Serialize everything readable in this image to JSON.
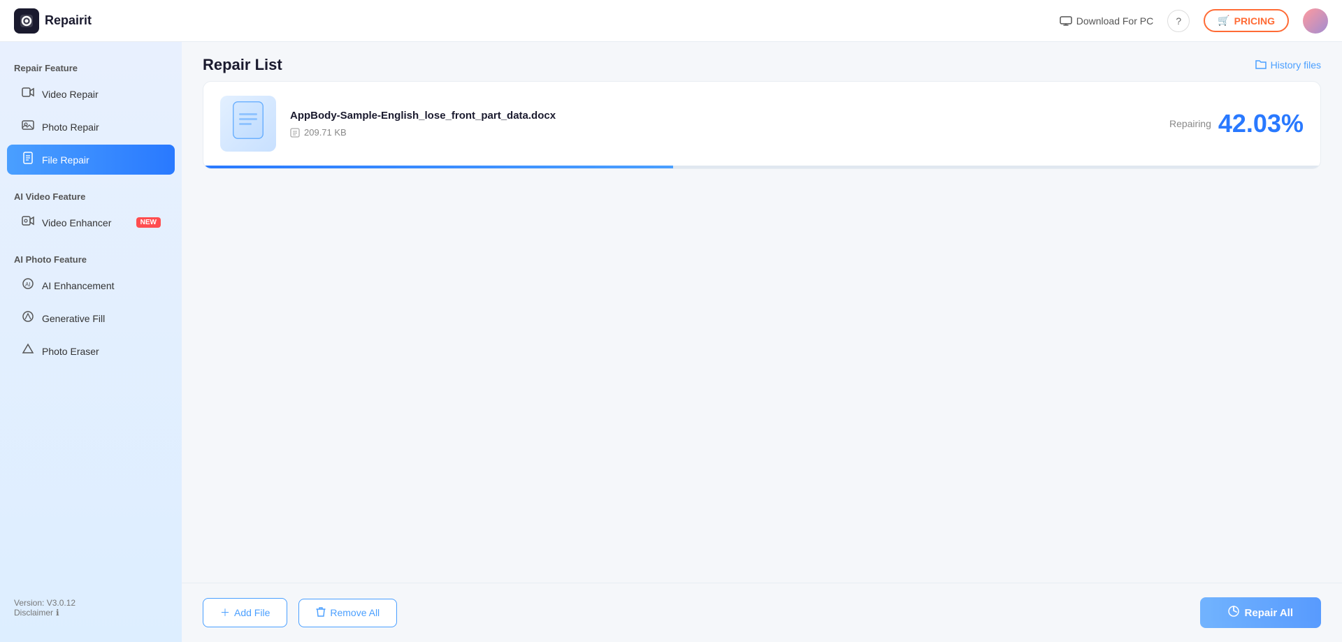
{
  "app": {
    "name": "Repairit"
  },
  "topbar": {
    "download_pc_label": "Download For PC",
    "pricing_label": "PRICING",
    "pricing_icon": "🛒"
  },
  "sidebar": {
    "sections": [
      {
        "label": "Repair Feature",
        "items": [
          {
            "id": "video-repair",
            "label": "Video Repair",
            "icon": "▶",
            "active": false,
            "badge": null
          },
          {
            "id": "photo-repair",
            "label": "Photo Repair",
            "icon": "🖼",
            "active": false,
            "badge": null
          },
          {
            "id": "file-repair",
            "label": "File Repair",
            "icon": "📄",
            "active": true,
            "badge": null
          }
        ]
      },
      {
        "label": "AI Video Feature",
        "items": [
          {
            "id": "video-enhancer",
            "label": "Video Enhancer",
            "icon": "✨",
            "active": false,
            "badge": "NEW"
          }
        ]
      },
      {
        "label": "AI Photo Feature",
        "items": [
          {
            "id": "ai-enhancement",
            "label": "AI Enhancement",
            "icon": "🤖",
            "active": false,
            "badge": null
          },
          {
            "id": "generative-fill",
            "label": "Generative Fill",
            "icon": "◇",
            "active": false,
            "badge": null
          },
          {
            "id": "photo-eraser",
            "label": "Photo Eraser",
            "icon": "◇",
            "active": false,
            "badge": null
          }
        ]
      }
    ],
    "version": "Version: V3.0.12",
    "disclaimer": "Disclaimer"
  },
  "content": {
    "title": "Repair List",
    "history_files_label": "History files",
    "file": {
      "name": "AppBody-Sample-English_lose_front_part_data.docx",
      "size": "209.71 KB",
      "status_label": "Repairing",
      "progress_percent": "42.03%",
      "progress_value": 42.03
    }
  },
  "toolbar": {
    "add_file_label": "Add File",
    "remove_all_label": "Remove All",
    "repair_all_label": "Repair All"
  }
}
